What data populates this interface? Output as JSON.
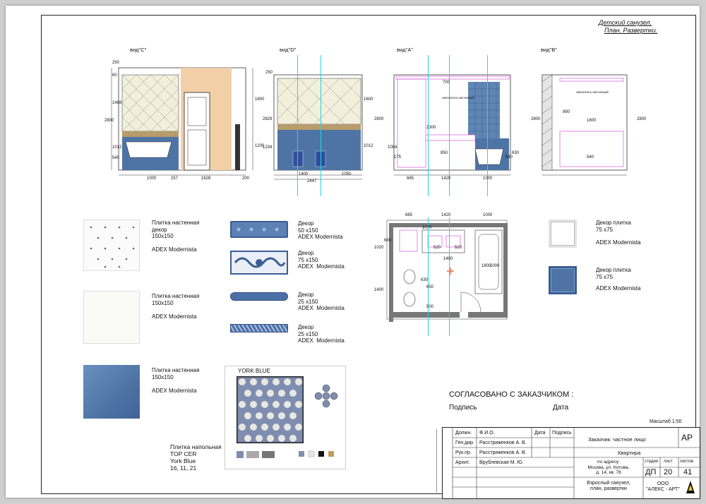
{
  "sheet_title": [
    "Детский санузел.",
    "План. Развертки."
  ],
  "views": [
    {
      "label": "вид\"С\"",
      "dims_left": [
        "250",
        "60",
        "1488",
        "2800",
        "1012",
        "540"
      ],
      "dims_right": [
        "1600",
        "1200"
      ],
      "dims_bottom": [
        "1000",
        "257",
        "1628",
        "200"
      ]
    },
    {
      "label": "вид\"D\"",
      "dims_left": [
        "250",
        "2829",
        "1234"
      ],
      "dims_right": [
        "1600",
        "1012"
      ],
      "dims_bottom": [
        "1400",
        "1050",
        "2447"
      ]
    },
    {
      "label": "вид\"А\"",
      "dims_left": [
        "2800",
        "1084",
        "175"
      ],
      "dims_mid": [
        "700",
        "2300",
        "850"
      ],
      "dims_right": [
        "540",
        "630"
      ],
      "dims_bottom": [
        "665",
        "1420",
        "1000"
      ],
      "note": "смеситель настенный"
    },
    {
      "label": "вид\"В\"",
      "dims_left": [
        "2800"
      ],
      "dims_mid": [
        "890",
        "1800",
        "540"
      ],
      "dims_right": [
        "2800"
      ],
      "note": "смеситель настенный"
    }
  ],
  "plan": {
    "dims_top": [
      "665",
      "1420",
      "1000"
    ],
    "dims_left": [
      "1020",
      "689",
      "1400"
    ],
    "dims_inner": [
      "1070",
      "520",
      "520",
      "1400",
      "1800",
      "2000",
      "630",
      "650",
      "500"
    ]
  },
  "materials_left": [
    {
      "name": "Плитка настенная\nдекор\n150х150",
      "brand": "ADEX  Modernista"
    },
    {
      "name": "Плитка настенная\n150х150",
      "brand": "ADEX  Modernista"
    },
    {
      "name": "Плитка настенная\n150х150",
      "brand": "ADEX  Modernista"
    }
  ],
  "materials_mid": [
    {
      "name": "Декор\n50 х150\nADEX Modernista"
    },
    {
      "name": "Декор\n75 х150\nADEX  Modernista"
    },
    {
      "name": "Декор\n25 х150\nADEX  Modernista"
    },
    {
      "name": "Декор\n25 х150\nADEX  Modernista"
    }
  ],
  "materials_right": [
    {
      "name": "Декор плитка\n75 х75",
      "brand": "ADEX  Modernista"
    },
    {
      "name": "Декор плитка\n75 х75",
      "brand": "ADEX  Modernista"
    }
  ],
  "floor_tile": {
    "header": "YORK  BLUE",
    "name": "Плитка напольная\nTOP CER\nYork Blue\n16, 11, 21"
  },
  "approval": {
    "title": "СОГЛАСОВАНО С ЗАКАЗЧИКОМ :",
    "sign": "Подпись",
    "date": "Дата"
  },
  "scale": "Масштаб  1:50",
  "stamp": {
    "headers": [
      "Должн.",
      "Ф.И.О.",
      "Дата",
      "Подпись"
    ],
    "rows": [
      [
        "Ген.дир.",
        "Расстриженков А. В."
      ],
      [
        "Рук.пр.",
        "Расстриженков А. В."
      ],
      [
        "Архит.",
        "Врублевская М. Ю."
      ]
    ],
    "customer": "Заказчик:   частное лицо",
    "code": "АР",
    "type": "Квартира",
    "address": "по адресу:\nМосква, ул. Котова,\nд. 14, кв. 78",
    "stage_label": "стадия",
    "sheet_label": "лист",
    "sheets_label": "листов",
    "stage": "ДП",
    "sheet": "20",
    "sheets": "41",
    "content": "Взрослый санузел,\nплан, развертки",
    "company": "ООО\n\"АЛЕКС - АРТ\""
  },
  "colors": {
    "blue_tile": "#4e74a6",
    "cyan_line": "#1bd7e5",
    "magenta_line": "#d63cd6",
    "wall_peach": "#f3cfa8"
  }
}
